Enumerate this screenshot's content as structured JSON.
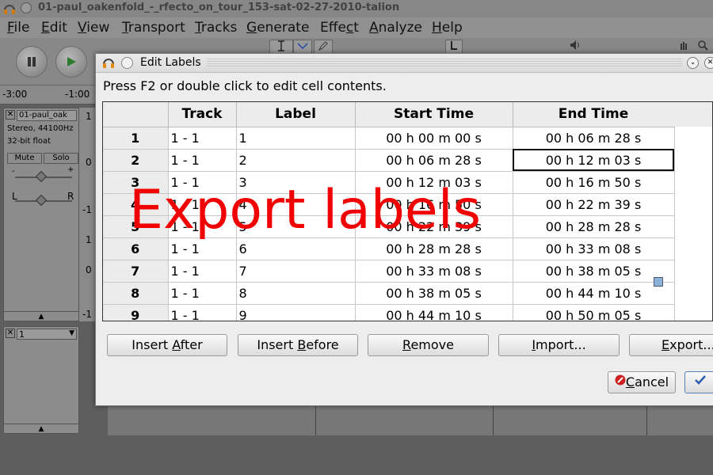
{
  "window": {
    "title": "01-paul_oakenfold_-_rfecto_on_tour_153-sat-02-27-2010-talion"
  },
  "menu": [
    {
      "pre": "",
      "u": "F",
      "post": "ile"
    },
    {
      "pre": "",
      "u": "E",
      "post": "dit"
    },
    {
      "pre": "",
      "u": "V",
      "post": "iew"
    },
    {
      "pre": "",
      "u": "T",
      "post": "ransport"
    },
    {
      "pre": "",
      "u": "T",
      "post": "racks"
    },
    {
      "pre": "",
      "u": "G",
      "post": "enerate"
    },
    {
      "pre": "Effe",
      "u": "c",
      "post": "t"
    },
    {
      "pre": "",
      "u": "A",
      "post": "nalyze"
    },
    {
      "pre": "",
      "u": "H",
      "post": "elp"
    }
  ],
  "ruler": {
    "left": "-3:00",
    "right": "-1:00"
  },
  "track": {
    "name": "01-paul_oak",
    "info_line1": "Stereo, 44100Hz",
    "info_line2": "32-bit float",
    "mute": "Mute",
    "solo": "Solo",
    "gain_minus": "-",
    "gain_plus": "+",
    "pan_left": "L",
    "pan_right": "R"
  },
  "wave_axis": [
    "1",
    "0",
    "-1",
    "1",
    "0",
    "-1"
  ],
  "label_track": {
    "name": "1"
  },
  "dialog": {
    "title": "Edit Labels",
    "instruction": "Press F2 or double click to edit cell contents.",
    "columns": [
      "Track",
      "Label",
      "Start Time",
      "End Time"
    ],
    "rows": [
      {
        "num": "1",
        "track": "1 - 1",
        "label": "1",
        "start": "00 h 00 m 00 s",
        "end": "00 h 06 m 28 s"
      },
      {
        "num": "2",
        "track": "1 - 1",
        "label": "2",
        "start": "00 h 06 m 28 s",
        "end": "00 h 12 m 03 s"
      },
      {
        "num": "3",
        "track": "1 - 1",
        "label": "3",
        "start": "00 h 12 m 03 s",
        "end": "00 h 16 m 50 s"
      },
      {
        "num": "4",
        "track": "1 - 1",
        "label": "4",
        "start": "00 h 16 m 50 s",
        "end": "00 h 22 m 39 s"
      },
      {
        "num": "5",
        "track": "1 - 1",
        "label": "5",
        "start": "00 h 22 m 39 s",
        "end": "00 h 28 m 28 s"
      },
      {
        "num": "6",
        "track": "1 - 1",
        "label": "6",
        "start": "00 h 28 m 28 s",
        "end": "00 h 33 m 08 s"
      },
      {
        "num": "7",
        "track": "1 - 1",
        "label": "7",
        "start": "00 h 33 m 08 s",
        "end": "00 h 38 m 05 s"
      },
      {
        "num": "8",
        "track": "1 - 1",
        "label": "8",
        "start": "00 h 38 m 05 s",
        "end": "00 h 44 m 10 s"
      },
      {
        "num": "9",
        "track": "1 - 1",
        "label": "9",
        "start": "00 h 44 m 10 s",
        "end": "00 h 50 m 05 s"
      }
    ],
    "selected_cell": {
      "row": 1,
      "col": "end"
    },
    "buttons": {
      "insert_after": {
        "pre": "Insert ",
        "u": "A",
        "post": "fter"
      },
      "insert_before": {
        "pre": "Insert ",
        "u": "B",
        "post": "efore"
      },
      "remove": {
        "pre": "",
        "u": "R",
        "post": "emove"
      },
      "import": {
        "pre": "",
        "u": "I",
        "post": "mport..."
      },
      "export": {
        "pre": "",
        "u": "E",
        "post": "xport..."
      },
      "cancel": {
        "pre": "",
        "u": "C",
        "post": "ancel"
      }
    }
  },
  "overlay_text": "Export labels",
  "colors": {
    "overlay": "#f00000",
    "cancel_icon": "#cc2222",
    "ok_check": "#2a5db0"
  },
  "icons": {
    "app": "headphones-icon",
    "cancel": "cancel-icon",
    "ok": "checkmark-icon"
  }
}
